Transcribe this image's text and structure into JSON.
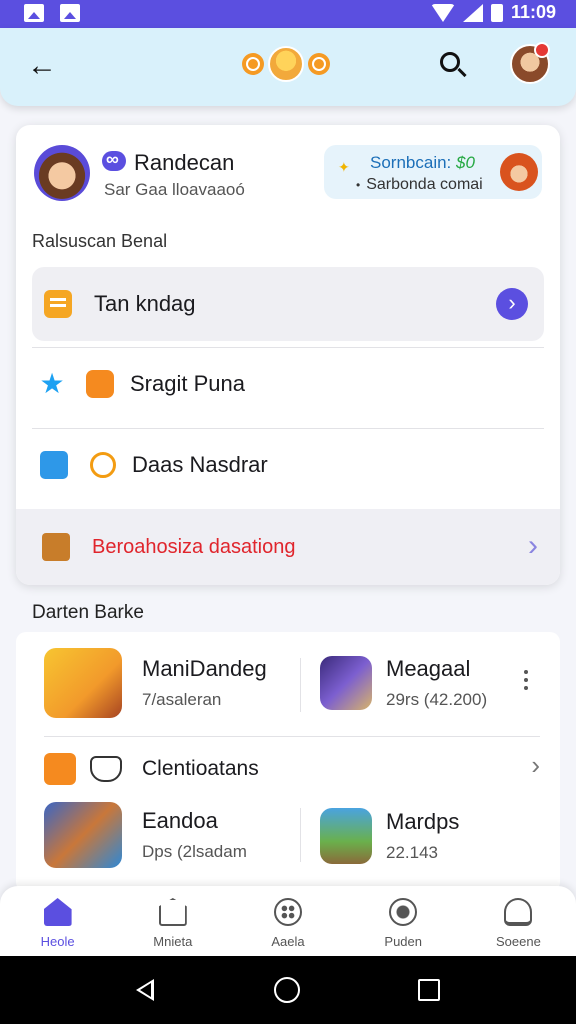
{
  "status_bar": {
    "time": "11:09"
  },
  "profile": {
    "name": "Randecan",
    "subtitle": "Sar Gaa lloavaaoó",
    "promo_title": "Sornbcain:",
    "promo_amount": "$0",
    "promo_sub": "Sarbonda comai"
  },
  "menu": {
    "section_label": "Ralsuscan Benal",
    "items": [
      {
        "label": "Tan kndag"
      },
      {
        "label": "Sragit Puna"
      },
      {
        "label": "Daas Nasdrar"
      },
      {
        "label": "Beroahosiza dasationg"
      }
    ]
  },
  "games": {
    "section_label": "Darten Barke",
    "items": [
      {
        "title": "ManiDandeg",
        "subtitle": "7/asaleran"
      },
      {
        "title": "Meagaal",
        "subtitle": "29rs (42.200)"
      },
      {
        "title": "Eandoa",
        "subtitle": "Dps (2lsadam"
      },
      {
        "title": "Mardps",
        "subtitle": "22.143"
      }
    ],
    "collection_label": "Clentioatans"
  },
  "bottom_nav": [
    {
      "label": "Heole"
    },
    {
      "label": "Mnieta"
    },
    {
      "label": "Aaela"
    },
    {
      "label": "Puden"
    },
    {
      "label": "Soeene"
    }
  ],
  "colors": {
    "accent": "#5b4fe0",
    "status_bar": "#5b4fe0",
    "app_bar": "#d9f1fb",
    "warning": "#e0252c"
  },
  "icons": [
    "back-arrow-icon",
    "search-icon",
    "star-icon",
    "compass-icon",
    "chevron-right-icon",
    "more-vert-icon",
    "home-icon"
  ]
}
